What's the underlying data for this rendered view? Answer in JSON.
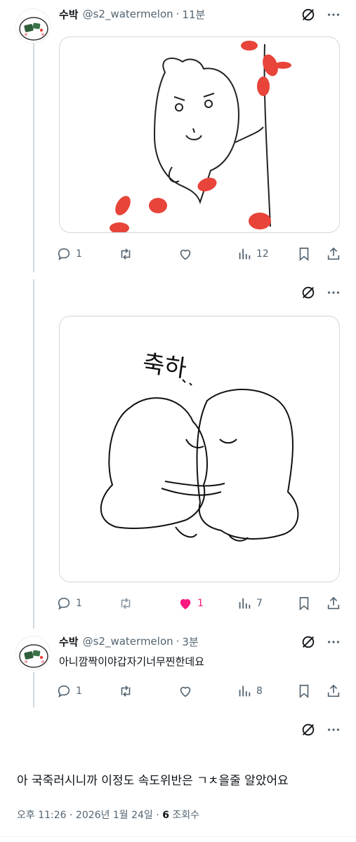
{
  "posts": [
    {
      "author_name": "수박",
      "handle": "@s2_watermelon",
      "time": "11분",
      "separator": "·",
      "media_description": "drawing of a white fluffy creature holding a stem with red petals",
      "stats": {
        "reply": "1",
        "retweet": "",
        "like": "",
        "views": "12"
      }
    },
    {
      "media_description": "line drawing of two blob creatures hugging, captioned",
      "media_caption": "축하",
      "stats": {
        "reply": "1",
        "retweet": "",
        "like": "1",
        "views": "7"
      },
      "liked": true
    },
    {
      "author_name": "수박",
      "handle": "@s2_watermelon",
      "time": "3분",
      "separator": "·",
      "text": "아니깜짝이야갑자기너무찐한데요",
      "stats": {
        "reply": "1",
        "retweet": "",
        "like": "",
        "views": "8"
      }
    }
  ],
  "main_post": {
    "text": "아 국죽러시니까 이정도 속도위반은 ㄱㅊ을줄 알았어요",
    "time": "오후 11:26",
    "separator": "·",
    "date": "2026년 1월 24일",
    "separator2": "·",
    "views_count": "6",
    "views_label": "조회수"
  },
  "icons": [
    "grok-icon",
    "more-icon",
    "reply-icon",
    "retweet-icon",
    "like-icon",
    "views-icon",
    "bookmark-icon",
    "share-icon"
  ],
  "colors": {
    "accent_like": "#f91880",
    "secondary_text": "#536471",
    "thread_line": "#cfd9de",
    "petal_red": "#e8443a"
  }
}
